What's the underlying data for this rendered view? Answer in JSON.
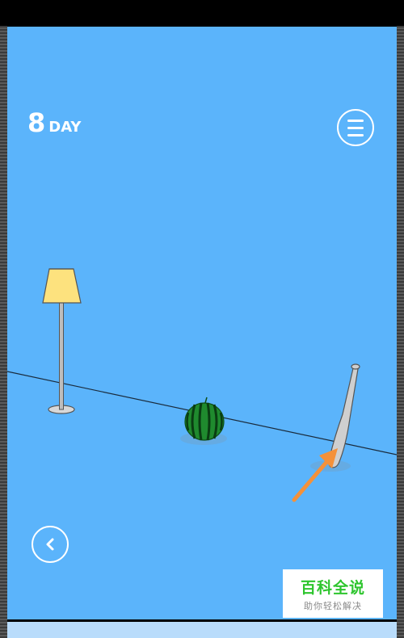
{
  "hud": {
    "day_number": "8",
    "day_word": "DAY"
  },
  "icons": {
    "menu": "hamburger-menu-icon",
    "back": "chevron-left-icon"
  },
  "scene_objects": [
    "floor-lamp",
    "watermelon",
    "baseball-bat",
    "hint-arrow"
  ],
  "watermark": {
    "title": "百科全说",
    "subtitle": "助你轻松解决"
  },
  "colors": {
    "background": "#5bb4fb",
    "lamp_shade": "#fde27e",
    "watermelon": "#1f8a2e",
    "bat": "#c9c9c9",
    "hint_arrow": "#f4913a",
    "watermark_green": "#2ec52e"
  }
}
